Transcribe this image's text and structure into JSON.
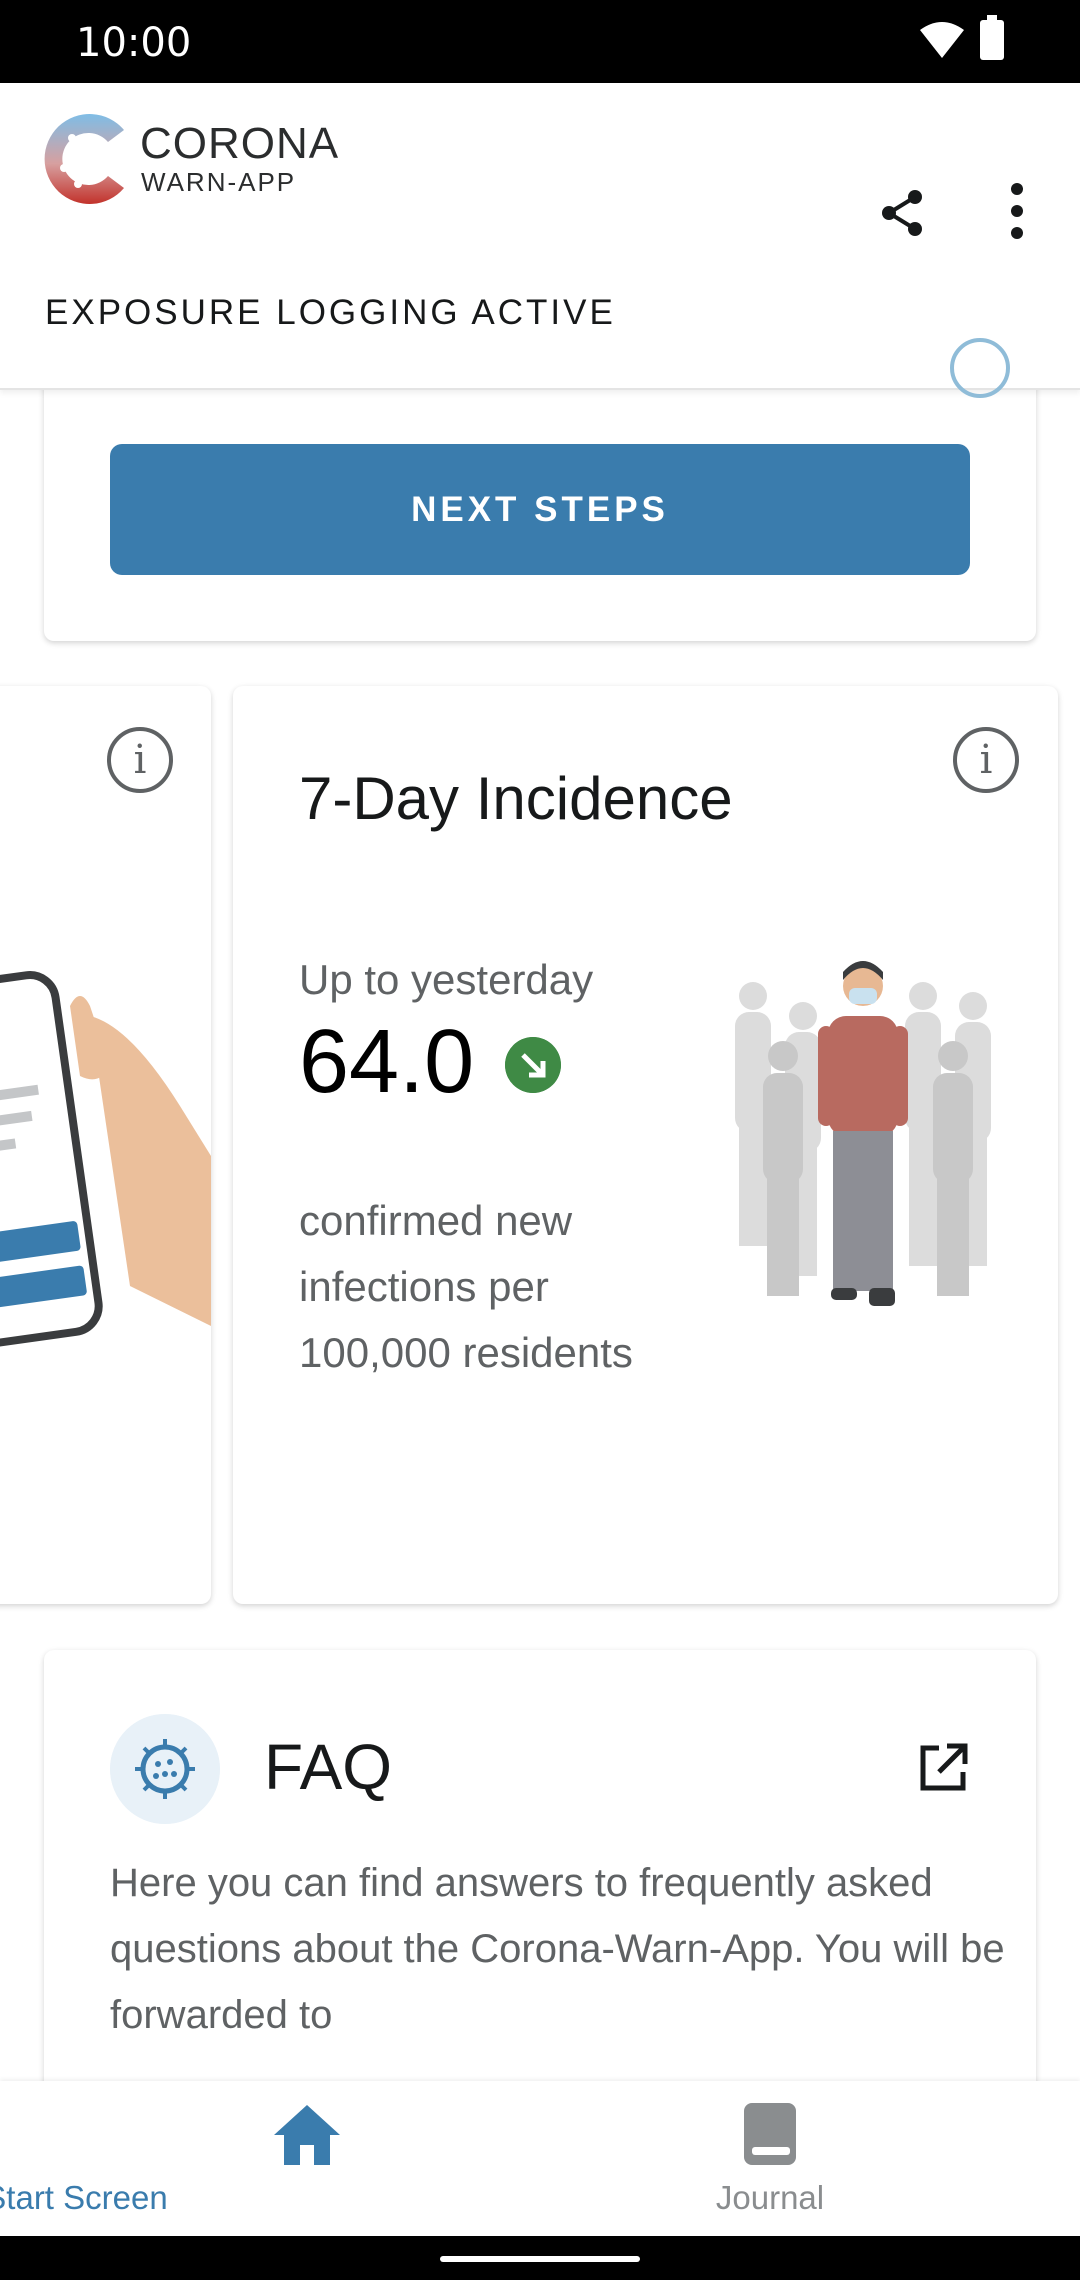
{
  "status_bar": {
    "time": "10:00"
  },
  "header": {
    "brand_line1": "CORONA",
    "brand_line2": "WARN-APP",
    "exposure_status": "EXPOSURE LOGGING ACTIVE"
  },
  "top_card": {
    "next_steps_label": "NEXT STEPS"
  },
  "incidence_card": {
    "title": "7-Day Incidence",
    "subtitle": "Up to yesterday",
    "value": "64.0",
    "trend": "down",
    "description": "confirmed new infections per 100,000 residents"
  },
  "faq_card": {
    "title": "FAQ",
    "text": "Here you can find answers to frequently asked questions about the Corona-Warn-App. You will be forwarded to"
  },
  "bottom_nav": {
    "items": [
      {
        "label": "Start Screen",
        "active": true
      },
      {
        "label": "Journal",
        "active": false
      }
    ]
  },
  "colors": {
    "accent": "#3a7cad",
    "trend_green": "#3f8a45"
  }
}
